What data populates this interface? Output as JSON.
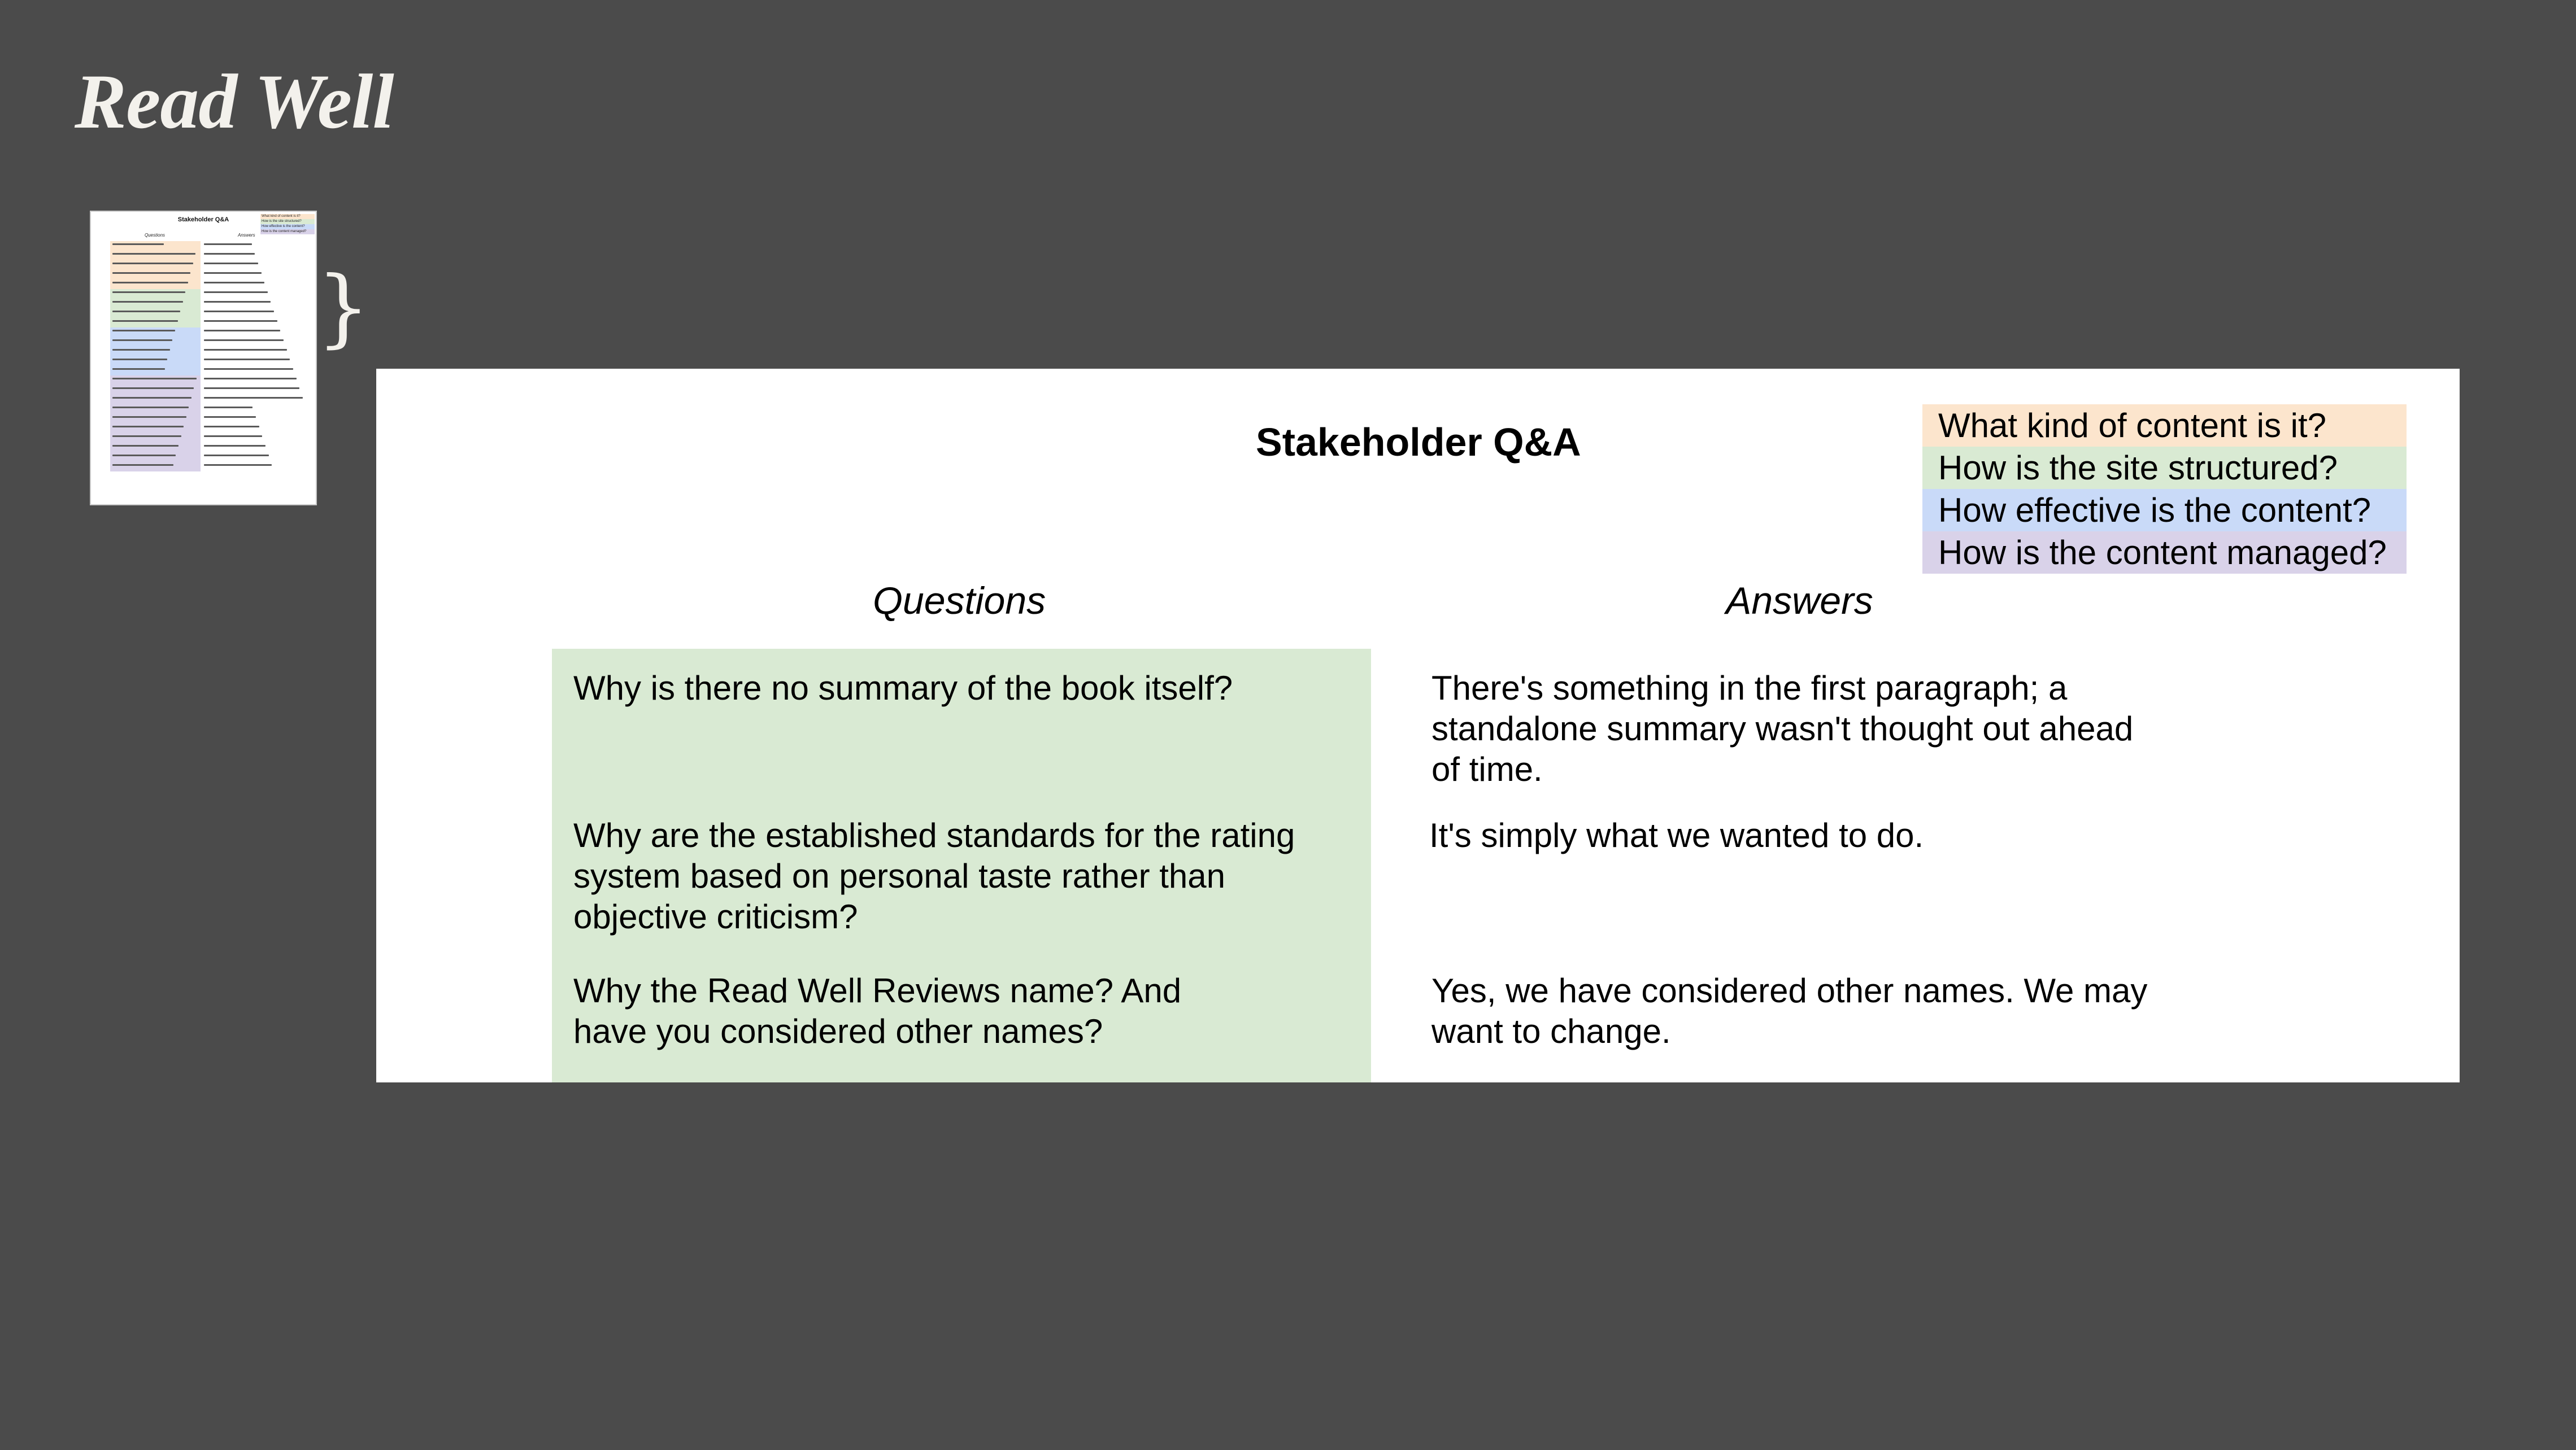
{
  "brand": {
    "name": "Read Well"
  },
  "thumbnail": {
    "title": "Stakeholder Q&A",
    "questions_header": "Questions",
    "answers_header": "Answers",
    "legend": [
      "What kind of content is it?",
      "How is the site structured?",
      "How effective is the content?",
      "How is the content managed?"
    ],
    "row_colors": [
      "#fce5cd",
      "#fce5cd",
      "#fce5cd",
      "#fce5cd",
      "#fce5cd",
      "#d9ead3",
      "#d9ead3",
      "#d9ead3",
      "#d9ead3",
      "#c9daf8",
      "#c9daf8",
      "#c9daf8",
      "#c9daf8",
      "#c9daf8",
      "#d9d2e9",
      "#d9d2e9",
      "#d9d2e9",
      "#d9d2e9",
      "#d9d2e9",
      "#d9d2e9",
      "#d9d2e9",
      "#d9d2e9",
      "#d9d2e9",
      "#d9d2e9"
    ]
  },
  "slide": {
    "title": "Stakeholder Q&A",
    "questions_header": "Questions",
    "answers_header": "Answers",
    "legend": [
      {
        "label": "What kind of content is it?",
        "color": "#fce5cd"
      },
      {
        "label": "How is the site structured?",
        "color": "#d9ead3"
      },
      {
        "label": "How effective is the content?",
        "color": "#c9daf8"
      },
      {
        "label": "How is the content managed?",
        "color": "#d9d2e9"
      }
    ],
    "rows": [
      {
        "question": "Why is there no summary of the book itself?",
        "answer": "There's something in the first paragraph; a standalone summary wasn't thought out ahead of time."
      },
      {
        "question": "Why are the established standards for the rating system based on personal taste rather than objective criticism?",
        "answer": "It's simply what we wanted to do."
      },
      {
        "question": "Why the Read Well Reviews name? And have you considered other names?",
        "answer": "Yes, we have considered other names. We may want to change."
      }
    ],
    "question_row_color": "#d9ead3"
  }
}
